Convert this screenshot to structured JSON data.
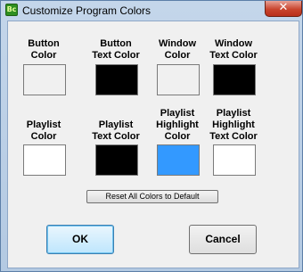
{
  "window": {
    "title": "Customize Program Colors",
    "icon_name": "app-icon",
    "icon_text": "Bc",
    "close_glyph": "✕"
  },
  "colors": [
    {
      "label": "Button\nColor",
      "color": "#f0f0f0"
    },
    {
      "label": "Button\nText Color",
      "color": "#000000"
    },
    {
      "label": "Window\nColor",
      "color": "#f0f0f0"
    },
    {
      "label": "Window\nText Color",
      "color": "#000000"
    },
    {
      "label": "Playlist\nColor",
      "color": "#ffffff"
    },
    {
      "label": "Playlist\nText Color",
      "color": "#000000"
    },
    {
      "label": "Playlist\nHighlight\nColor",
      "color": "#3399ff"
    },
    {
      "label": "Playlist\nHighlight\nText Color",
      "color": "#ffffff"
    }
  ],
  "buttons": {
    "reset_label": "Reset All Colors to Default",
    "ok_label": "OK",
    "cancel_label": "Cancel"
  }
}
